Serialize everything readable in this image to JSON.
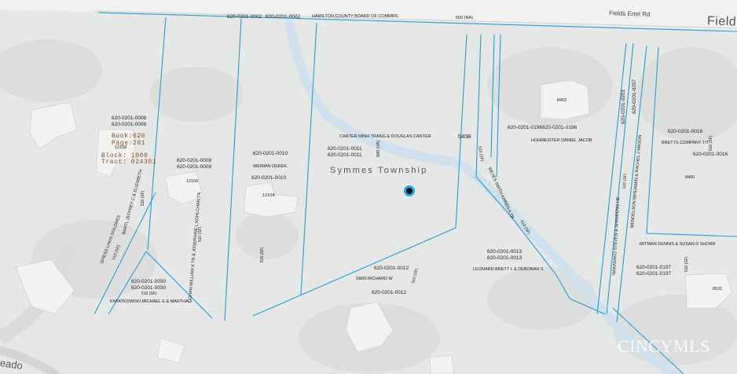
{
  "roads": {
    "fields_ertel": "Fields Ertel Rd",
    "fields_cut": "Field",
    "meadow_cut": "eado"
  },
  "township": "Symmes Township",
  "plat": {
    "book": "Book:620",
    "page": "Page:201",
    "block": "Block: 1000",
    "tract": "Tract: 024301"
  },
  "parcels": {
    "p0002_a": "620-0201-0002",
    "p0002_b": "620-0201-0002",
    "hamilton": "HAMILTON COUNTY BOARD OF COMMRS",
    "p0002_code": "500 (NA)",
    "p0008_a": "620-0201-0008",
    "p0008_b": "620-0201-0008",
    "p0008_num": "12108",
    "p0009_a": "620-0201-0009",
    "p0009_b": "620-0201-0009",
    "p0009_num": "12106",
    "p0010_a": "620-0201-0010",
    "p0010_owner": "WEIMAN DEREK",
    "p0010_b": "620-0201-0010",
    "p0010_num": "12104",
    "p0011_a": "620-0201-0011",
    "p0011_b": "620-0201-0011",
    "p0011_owner": "CANTER MINH TRANG & DOUGLAS CANTER",
    "p0011_code": "500 (VA)",
    "p0011_lot": "540B",
    "p0196": "620-0201-0196620-0201-0196",
    "p0196_owner": "HOHMEISTER DANIEL JACOB",
    "p0196_num": "8453",
    "p0016_a": "620-0201-0016",
    "p0016_owner": "BRETTS COMPANY TIT",
    "p0016_b": "620-0201-0016",
    "p0016_num": "8460",
    "p0016_code": "510 (SF)",
    "p0012_a": "620-0201-0012",
    "p0012_owner": "SIMS RICHARD W",
    "p0012_b": "620-0201-0012",
    "p0012_code": "510 (SF)",
    "p0013_a": "620-0201-0013",
    "p0013_b": "620-0201-0013",
    "p0013_owner": "LEONARD BRETT L & DEBORAH S",
    "p0013_code": "510 (SF)",
    "p0030_a": "620-0201-0030",
    "p0030_b": "620-0201-0030",
    "p0030_code": "510 (SF)",
    "p0030_owner": "KWIATKOWSKI MICHAEL E & MARTHA J",
    "p0197_owner": "MITMAN DENNIS & SUSAN D SHORR",
    "p0197_a": "620-0201-0197",
    "p0197_b": "620-0201-0197",
    "p0197_num": "8531",
    "p0197_code": "510 (SF)",
    "p0201": "620-0201-0201",
    "p0207": "620-0201-0207",
    "v_bartl": "BARTL JEFFREY C & ELIZABETH",
    "v_bartl_code": "510 (SF)",
    "v_spiess": "SPIESS LAKIS DOLORES",
    "v_spiess_code": "510 (SF)",
    "v_cohan": "COHAN WILLIAM K TR & JOSEPHINE L KOHLCHAN TR",
    "v_cohan_code": "510 (SF)",
    "v_0010_code": "510 (SF)",
    "v_smith": "REYES SMITH KAREN A TR",
    "v_smith_code": "510 (SF)",
    "v_nakasako": "NAKASAKO STEVEN & SHAVEENG HE",
    "v_nakasako_code": "510 (SF)",
    "v_mason": "MENDELSON BENJAMIN & RACHEL J MASON"
  },
  "watermark": "CINCYMLS",
  "colors": {
    "parcel_line": "#1f9fd8",
    "background": "#e6e7e7",
    "building": "#f2f2f0",
    "plat_text": "#8a4b22"
  }
}
